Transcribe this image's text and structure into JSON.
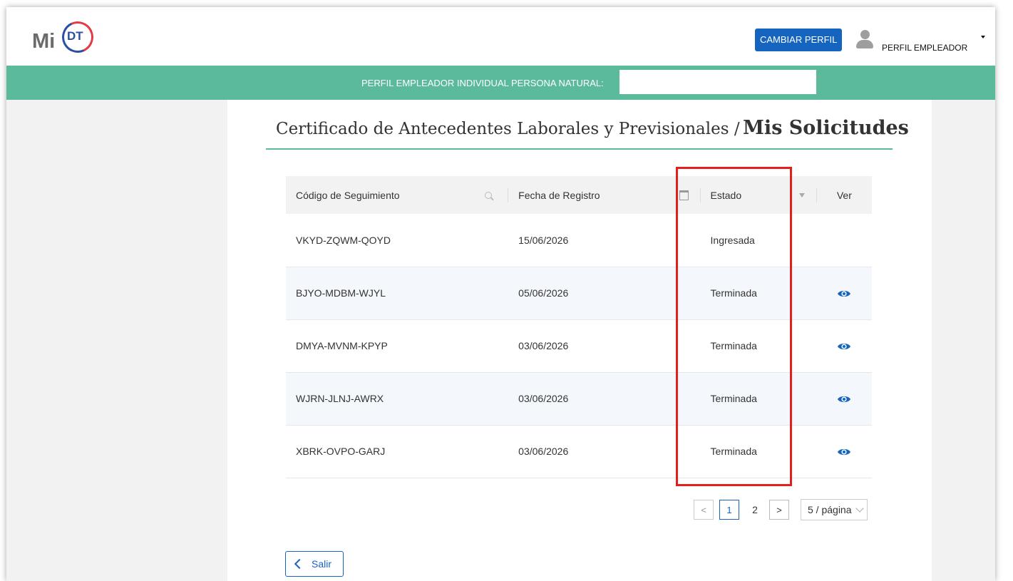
{
  "header": {
    "logo_prefix": "Mi",
    "logo_mark": "DT",
    "change_profile_button": "CAMBIAR PERFIL",
    "user_profile_label": "PERFIL EMPLEADOR"
  },
  "banner": {
    "text": "PERFIL EMPLEADOR INDIVIDUAL PERSONA NATURAL:",
    "name_value": ""
  },
  "page": {
    "title_prefix": "Certificado de Antecedentes Laborales y Previsionales /",
    "title_main": "Mis Solicitudes"
  },
  "table": {
    "columns": [
      "Código de Seguimiento",
      "Fecha de Registro",
      "Estado",
      "Ver"
    ],
    "rows": [
      {
        "code": "VKYD-ZQWM-QOYD",
        "date": "15/06/2026",
        "status": "Ingresada",
        "view": false
      },
      {
        "code": "BJYO-MDBM-WJYL",
        "date": "05/06/2026",
        "status": "Terminada",
        "view": true
      },
      {
        "code": "DMYA-MVNM-KPYP",
        "date": "03/06/2026",
        "status": "Terminada",
        "view": true
      },
      {
        "code": "WJRN-JLNJ-AWRX",
        "date": "03/06/2026",
        "status": "Terminada",
        "view": true
      },
      {
        "code": "XBRK-OVPO-GARJ",
        "date": "03/06/2026",
        "status": "Terminada",
        "view": true
      }
    ]
  },
  "pagination": {
    "prev": "<",
    "pages": [
      "1",
      "2"
    ],
    "current_page": "1",
    "next": ">",
    "page_size": "5 / página"
  },
  "footer": {
    "exit_button": "Salir"
  },
  "colors": {
    "accent_green": "#5bba9c",
    "primary_blue": "#1565c0",
    "highlight_red": "#e0201c"
  },
  "icons": [
    "search-icon",
    "calendar-icon",
    "filter-icon",
    "eye-icon",
    "user-icon",
    "chevron-down-icon",
    "back-icon"
  ]
}
